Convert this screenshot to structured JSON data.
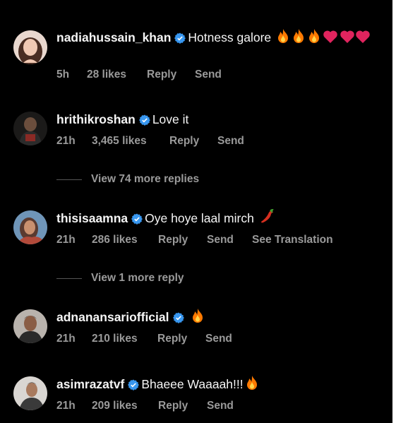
{
  "comments": [
    {
      "username": "nadiahussain_khan",
      "verified": true,
      "text": "Hotness galore",
      "emojis": [
        "fire",
        "fire",
        "fire",
        "heart",
        "heart",
        "heart"
      ],
      "time": "5h",
      "likes": "28 likes",
      "actions": [
        "Reply",
        "Send"
      ]
    },
    {
      "username": "hrithikroshan",
      "verified": true,
      "text": "Love it",
      "emojis": [],
      "time": "21h",
      "likes": "3,465 likes",
      "actions": [
        "Reply",
        "Send"
      ],
      "view_more": "View 74 more replies"
    },
    {
      "username": "thisisaamna",
      "verified": true,
      "text": "Oye hoye laal mirch",
      "emojis": [
        "chili-pepper"
      ],
      "time": "21h",
      "likes": "286 likes",
      "actions": [
        "Reply",
        "Send",
        "See Translation"
      ],
      "view_more": "View 1 more reply"
    },
    {
      "username": "adnanansariofficial",
      "verified": true,
      "text": "",
      "emojis": [
        "fire"
      ],
      "time": "21h",
      "likes": "210 likes",
      "actions": [
        "Reply",
        "Send"
      ]
    },
    {
      "username": "asimrazatvf",
      "verified": true,
      "text": "Bhaeee Waaaah!!!",
      "emojis": [
        "fire"
      ],
      "time": "21h",
      "likes": "209 likes",
      "actions": [
        "Reply",
        "Send"
      ]
    }
  ],
  "colors": {
    "background": "#000000",
    "text": "#f5f5f5",
    "meta": "#9a9a9a",
    "verified_badge": "#3897f0",
    "fire": "#ff7a00",
    "heart": "#e0245e"
  }
}
